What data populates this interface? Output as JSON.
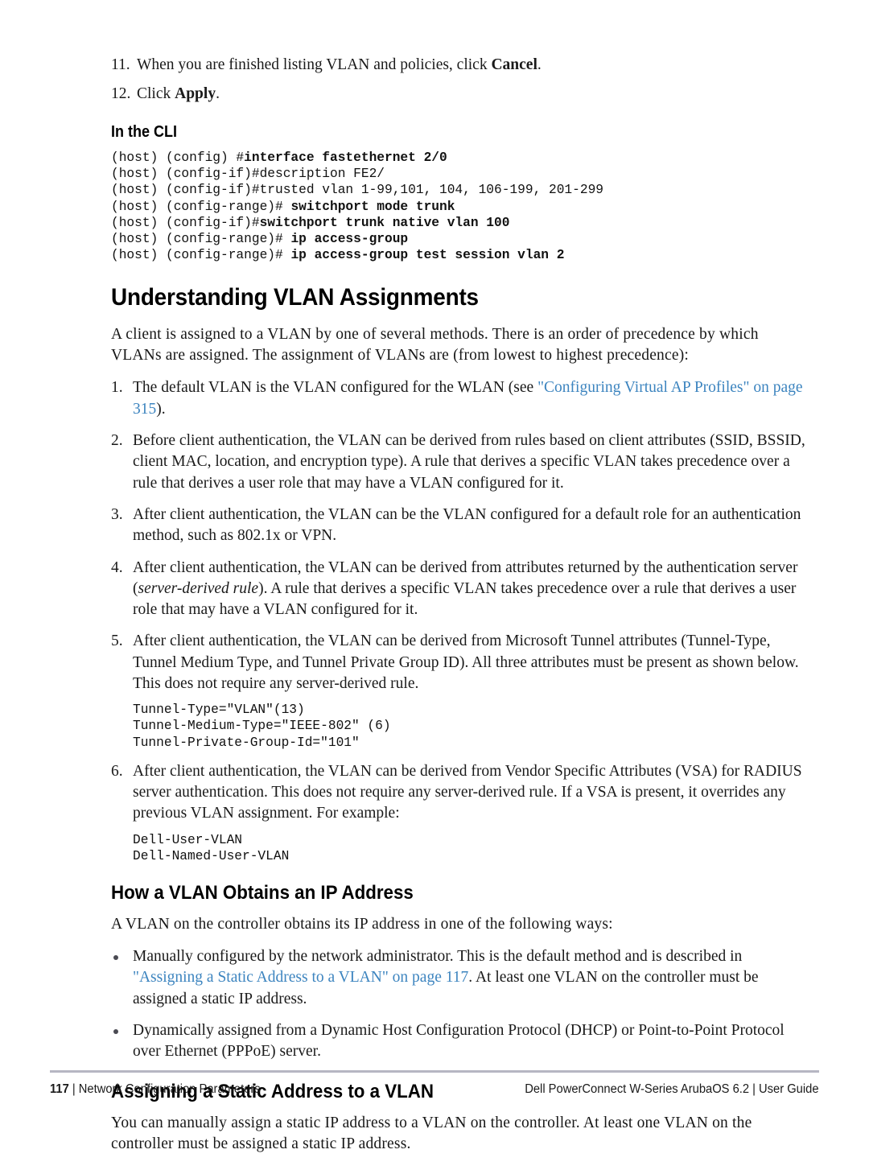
{
  "page": {
    "procedure_steps": [
      {
        "num": "11.",
        "pre": "When you are finished listing VLAN and policies, click ",
        "bold": "Cancel",
        "post": "."
      },
      {
        "num": "12.",
        "pre": "Click ",
        "bold": "Apply",
        "post": "."
      }
    ],
    "cli_heading": "In the CLI",
    "cli_lines": [
      {
        "prompt": "(host) (config) #",
        "command": "interface fastethernet 2/0"
      },
      {
        "prompt": "(host) (config-if)#",
        "command": "description FE2/",
        "plain": true
      },
      {
        "prompt": "(host) (config-if)#",
        "command": "trusted vlan 1-99,101, 104, 106-199, 201-299",
        "plain": true
      },
      {
        "prompt": "(host) (config-range)# ",
        "command": "switchport mode trunk"
      },
      {
        "prompt": "(host) (config-if)#",
        "command": "switchport trunk native vlan 100"
      },
      {
        "prompt": "(host) (config-range)# ",
        "command": "ip access-group"
      },
      {
        "prompt": "(host) (config-range)# ",
        "command": "ip access-group test session vlan 2"
      }
    ],
    "section1": {
      "heading": "Understanding VLAN Assignments",
      "intro": "A client is assigned to a VLAN by one of several methods. There is an order of precedence by which VLANs are assigned. The assignment of VLANs are (from lowest to highest precedence):",
      "items": [
        {
          "num": "1.",
          "parts": [
            {
              "t": "text",
              "v": "The default VLAN is the VLAN configured for the WLAN (see "
            },
            {
              "t": "link",
              "v": "\"Configuring Virtual AP Profiles\" on page 315"
            },
            {
              "t": "text",
              "v": ")."
            }
          ]
        },
        {
          "num": "2.",
          "parts": [
            {
              "t": "text",
              "v": "Before client authentication, the VLAN can be derived from rules based on client attributes (SSID, BSSID, client MAC, location, and encryption type). A rule that derives a specific VLAN takes precedence over a rule that derives a user role that may have a VLAN configured for it."
            }
          ]
        },
        {
          "num": "3.",
          "parts": [
            {
              "t": "text",
              "v": "After client authentication, the VLAN can be the VLAN configured for a default role for an authentication method, such as 802.1x or VPN."
            }
          ]
        },
        {
          "num": "4.",
          "parts": [
            {
              "t": "text",
              "v": "After client authentication, the VLAN can be derived from attributes returned by the authentication server ("
            },
            {
              "t": "italic",
              "v": "server-derived rule"
            },
            {
              "t": "text",
              "v": "). A rule that derives a specific VLAN takes precedence over a rule that derives a user role that may have a VLAN configured for it."
            }
          ]
        },
        {
          "num": "5.",
          "parts": [
            {
              "t": "text",
              "v": "After client authentication, the VLAN can be derived from Microsoft Tunnel attributes (Tunnel-Type, Tunnel Medium Type, and Tunnel Private Group ID). All three attributes must be present as shown below. This does not require any server-derived rule."
            }
          ],
          "code": "Tunnel-Type=\"VLAN\"(13)\nTunnel-Medium-Type=\"IEEE-802\" (6)\nTunnel-Private-Group-Id=\"101\""
        },
        {
          "num": "6.",
          "parts": [
            {
              "t": "text",
              "v": "After client authentication, the VLAN can be derived from Vendor Specific Attributes (VSA) for RADIUS server authentication. This does not require any server-derived rule. If a VSA is present, it overrides any previous VLAN assignment. For example:"
            }
          ],
          "code": "Dell-User-VLAN\nDell-Named-User-VLAN"
        }
      ]
    },
    "section2": {
      "heading": "How a VLAN Obtains an IP Address",
      "intro": "A VLAN on the controller obtains its IP address in one of the following ways:",
      "bullets": [
        {
          "parts": [
            {
              "t": "text",
              "v": "Manually configured by the network administrator. This is the default method and is described in "
            },
            {
              "t": "link",
              "v": "\"Assigning a Static Address to a VLAN\" on page 117"
            },
            {
              "t": "text",
              "v": ". At least one VLAN on the controller must be assigned a static IP address."
            }
          ]
        },
        {
          "parts": [
            {
              "t": "text",
              "v": "Dynamically assigned from a Dynamic Host Configuration Protocol (DHCP) or Point-to-Point Protocol over Ethernet (PPPoE) server."
            }
          ]
        }
      ]
    },
    "section3": {
      "heading": "Assigning a Static Address to a VLAN",
      "body": "You can manually assign a static IP address to a VLAN on the controller. At least one VLAN on the controller must be assigned a static IP address."
    },
    "footer": {
      "page_number": "117",
      "separator": " | ",
      "chapter": "Network Configuration Parameters",
      "guide": "Dell PowerConnect W-Series ArubaOS 6.2 | User Guide"
    },
    "colors": {
      "link": "#3c84bf",
      "rule": "#b6b6c3",
      "text": "#171717"
    }
  }
}
